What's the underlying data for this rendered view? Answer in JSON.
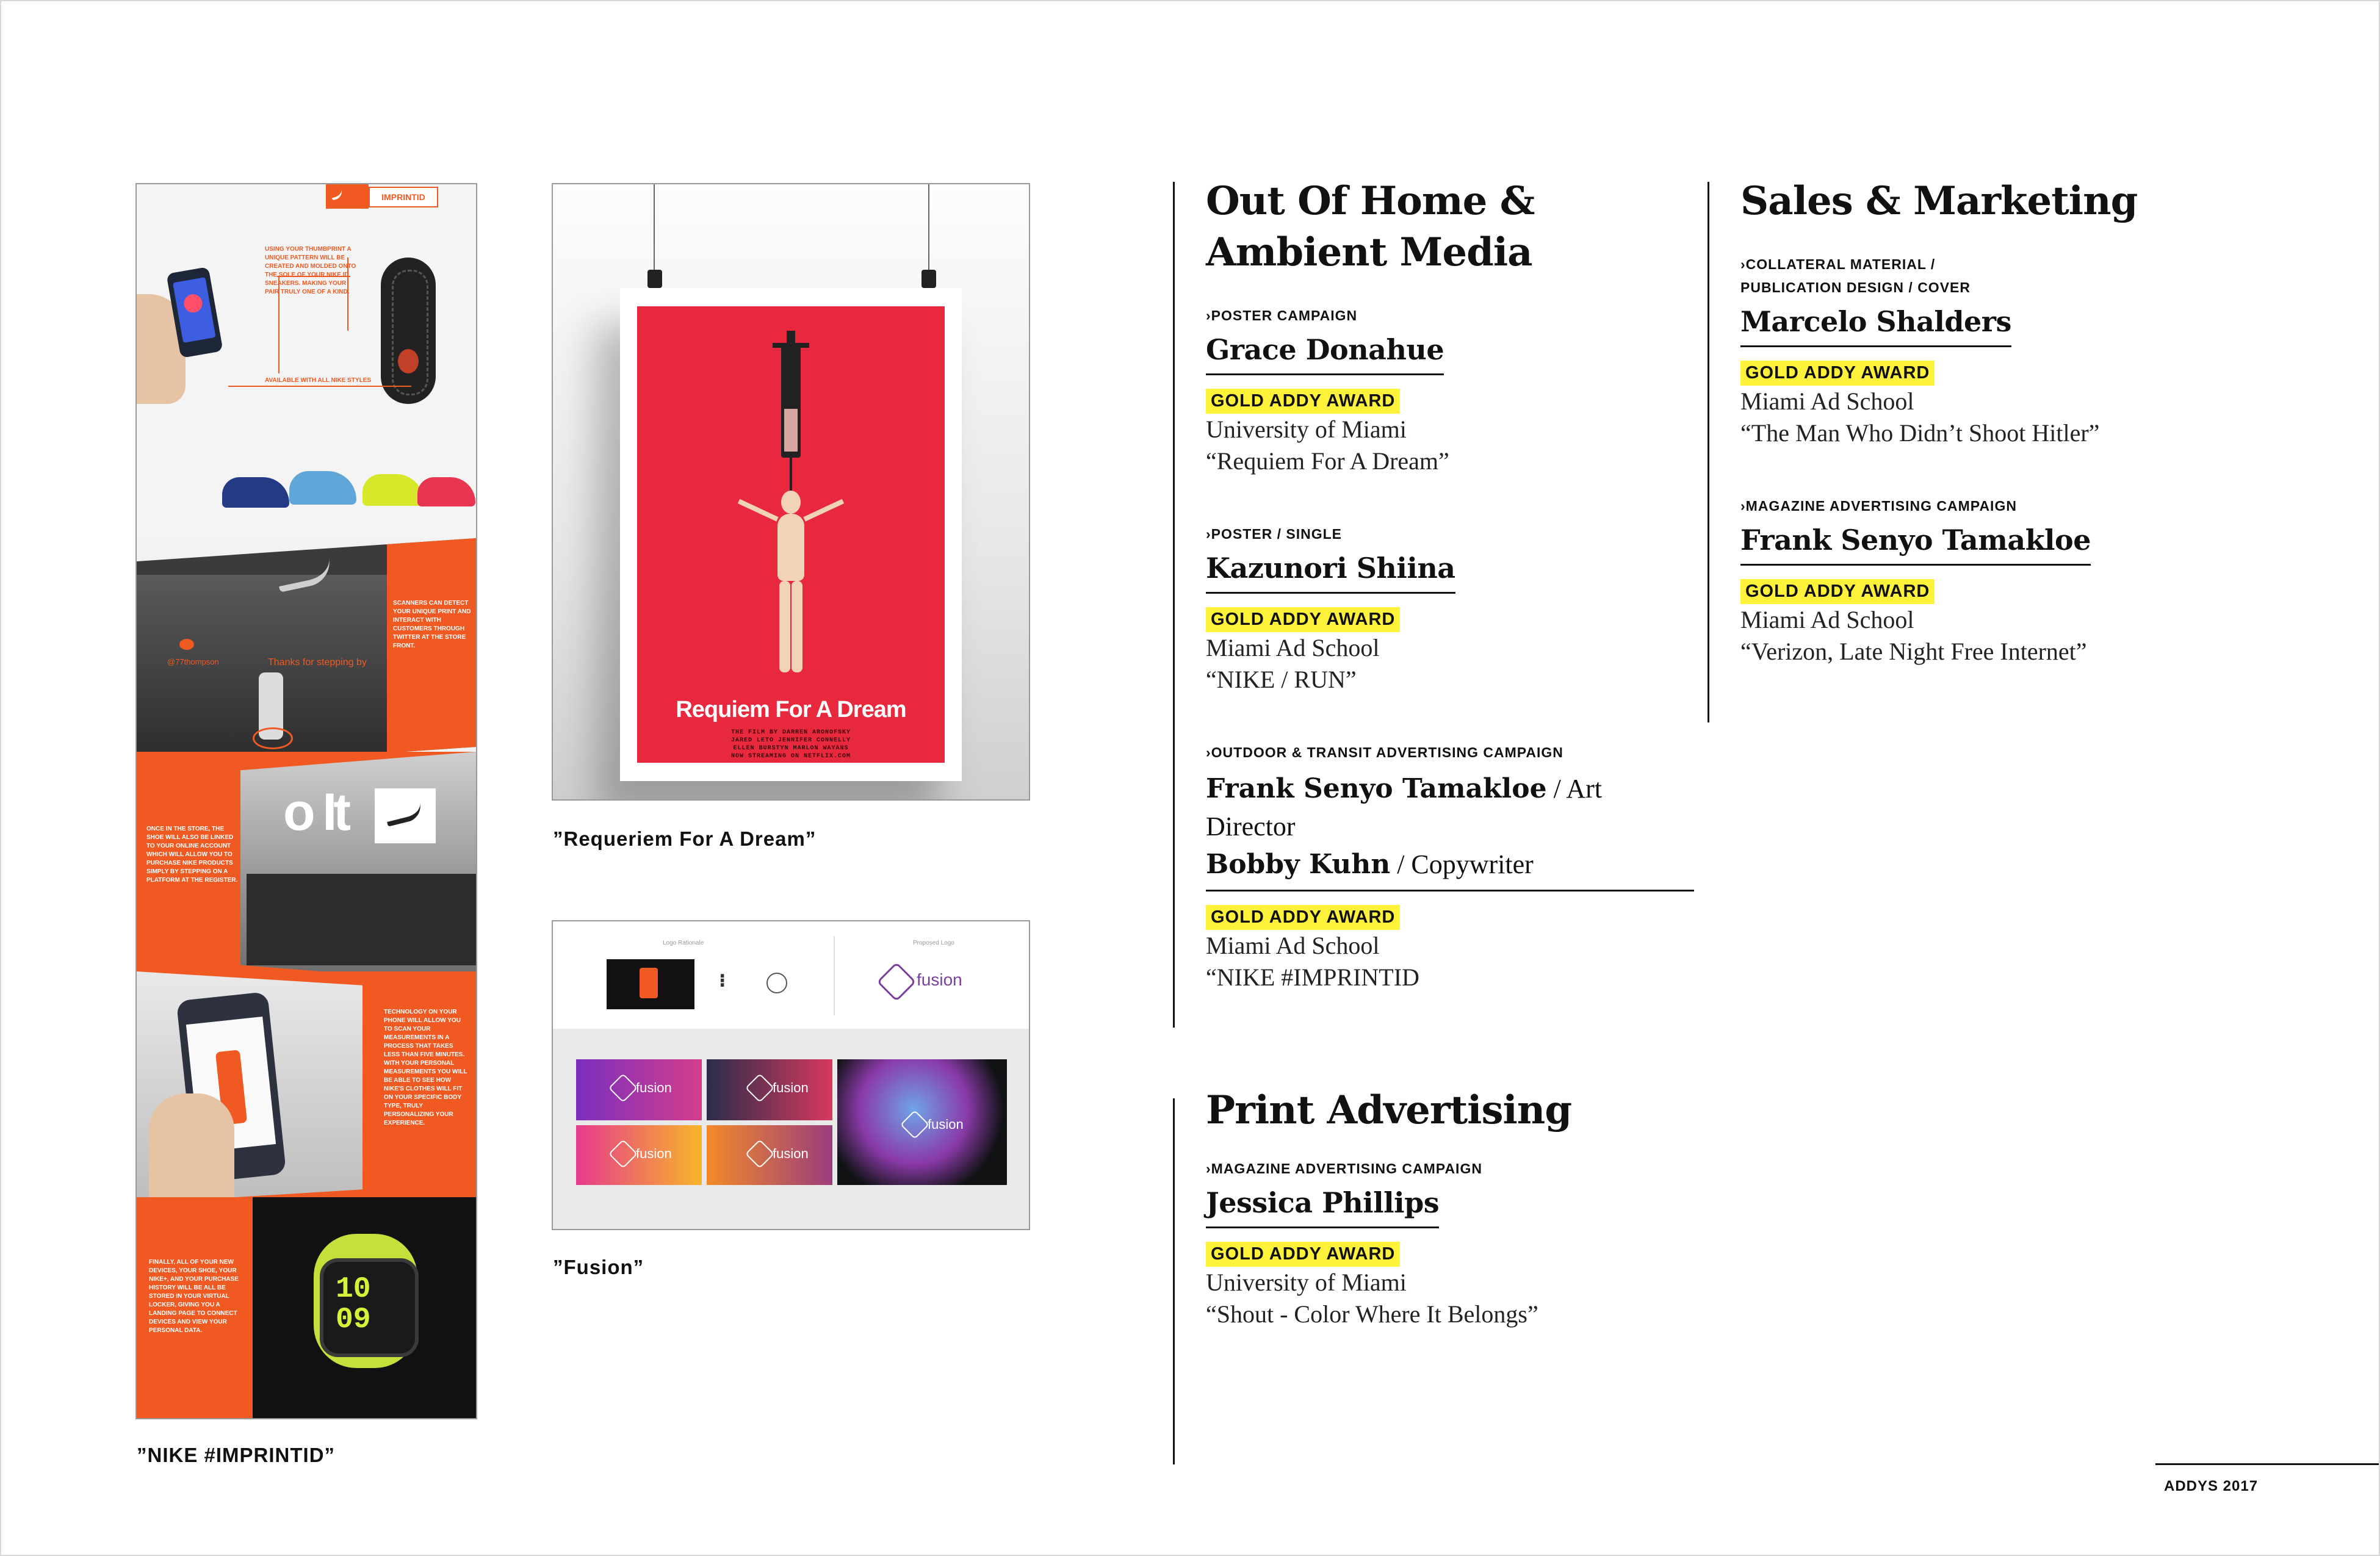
{
  "captions": {
    "nike": "”NIKE #IMPRINTID”",
    "requiem": "”Requeriem For A Dream”",
    "fusion": "”Fusion”"
  },
  "nike_panel": {
    "logo_text": "IMPRINTID",
    "intro": "Using your thumbprint a unique pattern will be created and molded onto the sole of your Nike ID sneakers. Making your pair truly one of a kind.",
    "styles_note": "Available with all Nike styles",
    "twitter_handle": "@77thompson",
    "twitter_msg": "Thanks for stepping by",
    "scanners": "Scanners can detect your unique print and interact with customers through twitter at the store front.",
    "store": "Once in the store, the shoe will also be linked to your online account which will allow you to purchase Nike products simply by stepping on a platform at the register.",
    "phone": "Technology on your phone will allow you to scan your measurements in a process that takes less than five minutes. With your personal measurements you will be able to see how Nike's clothes will fit on your specific body type, truly personalizing your experience.",
    "devices": "Finally, all of your new devices, your shoe, your Nike+, and your purchase history will be all be stored in your virtual locker, giving you a landing page to connect devices and view your personal data.",
    "watch_time": "10 09"
  },
  "poster": {
    "title": "Requiem For A Dream",
    "credits": [
      "THE FILM BY DARREN ARONOFSKY",
      "JARED LETO  JENNIFER CONNELLY",
      "ELLEN BURSTYN  MARLON WAYANS",
      "NOW STREAMING ON NETFLIX.COM"
    ]
  },
  "fusion_board": {
    "logo_word": "fusion",
    "label_left": "Logo Rationale",
    "label_right": "Proposed Logo"
  },
  "sections": {
    "ooh": {
      "title_line1": "Out Of Home &",
      "title_line2": "Ambient Media",
      "entries": [
        {
          "category": "›POSTER CAMPAIGN",
          "name": "Grace Donahue",
          "award": "GOLD ADDY AWARD",
          "school": "University of Miami",
          "work": "“Requiem For A Dream”"
        },
        {
          "category": "›POSTER / SINGLE",
          "name": "Kazunori Shiina",
          "award": "GOLD ADDY AWARD",
          "school": "Miami Ad School",
          "work": "“NIKE / RUN”"
        },
        {
          "category": "›OUTDOOR & TRANSIT ADVERTISING CAMPAIGN",
          "name1": "Frank Senyo Tamakloe",
          "role1": " / Art Director",
          "name2": "Bobby Kuhn",
          "role2": " / Copywriter",
          "award": "GOLD ADDY AWARD",
          "school": "Miami Ad School",
          "work": "“NIKE #IMPRINTID"
        }
      ]
    },
    "print": {
      "title": "Print Advertising",
      "entries": [
        {
          "category": "›MAGAZINE ADVERTISING CAMPAIGN",
          "name": "Jessica Phillips",
          "award": "GOLD ADDY AWARD",
          "school": "University of Miami",
          "work": "“Shout - Color Where It Belongs”"
        }
      ]
    },
    "sales": {
      "title": "Sales & Marketing",
      "entries": [
        {
          "category_line1": "›COLLATERAL MATERIAL /",
          "category_line2": "PUBLICATION DESIGN / COVER",
          "name": "Marcelo Shalders",
          "award": "GOLD ADDY AWARD",
          "school": "Miami Ad School",
          "work": "“The Man Who Didn’t Shoot Hitler”"
        },
        {
          "category": "›MAGAZINE ADVERTISING CAMPAIGN",
          "name": "Frank Senyo Tamakloe",
          "award": "GOLD ADDY AWARD",
          "school": "Miami Ad School",
          "work": "“Verizon, Late Night Free Internet”"
        }
      ]
    }
  },
  "footer": {
    "label": "ADDYS 2017"
  },
  "colors": {
    "highlight": "#fff23b",
    "nike_orange": "#f05a22",
    "poster_red": "#e8283d",
    "fusion_purple": "#7b3fa0"
  }
}
